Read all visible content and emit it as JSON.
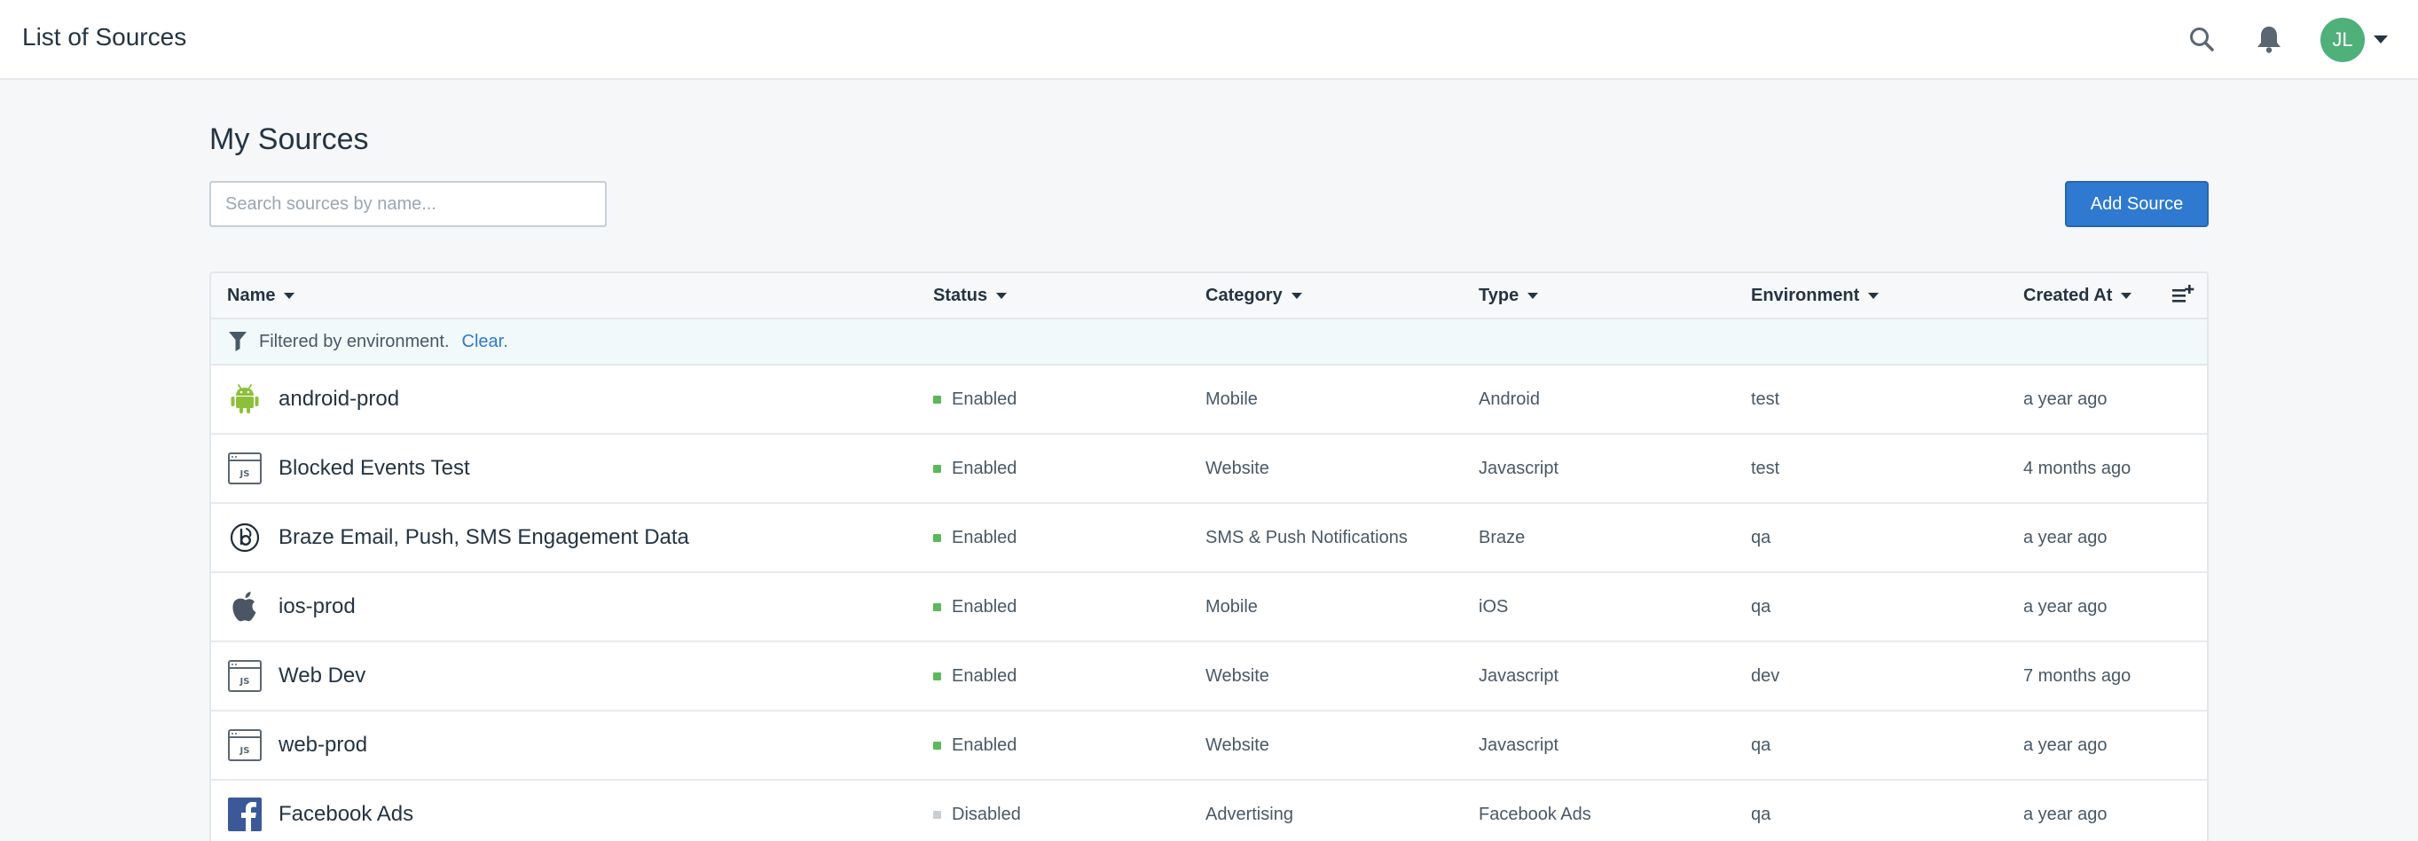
{
  "header": {
    "title": "List of Sources",
    "avatar_initials": "JL"
  },
  "page": {
    "title": "My Sources",
    "search_placeholder": "Search sources by name...",
    "add_button_label": "Add Source"
  },
  "table": {
    "columns": [
      {
        "label": "Name"
      },
      {
        "label": "Status"
      },
      {
        "label": "Category"
      },
      {
        "label": "Type"
      },
      {
        "label": "Environment"
      },
      {
        "label": "Created At"
      }
    ],
    "filter": {
      "text": "Filtered by environment.",
      "clear_label": "Clear."
    },
    "rows": [
      {
        "name": "android-prod",
        "icon": "android-icon",
        "status": "Enabled",
        "category": "Mobile",
        "type": "Android",
        "environment": "test",
        "created_at": "a year ago"
      },
      {
        "name": "Blocked Events Test",
        "icon": "javascript-icon",
        "status": "Enabled",
        "category": "Website",
        "type": "Javascript",
        "environment": "test",
        "created_at": "4 months ago"
      },
      {
        "name": "Braze Email, Push, SMS Engagement Data",
        "icon": "braze-icon",
        "status": "Enabled",
        "category": "SMS & Push Notifications",
        "type": "Braze",
        "environment": "qa",
        "created_at": "a year ago"
      },
      {
        "name": "ios-prod",
        "icon": "apple-icon",
        "status": "Enabled",
        "category": "Mobile",
        "type": "iOS",
        "environment": "qa",
        "created_at": "a year ago"
      },
      {
        "name": "Web Dev",
        "icon": "javascript-icon",
        "status": "Enabled",
        "category": "Website",
        "type": "Javascript",
        "environment": "dev",
        "created_at": "7 months ago"
      },
      {
        "name": "web-prod",
        "icon": "javascript-icon",
        "status": "Enabled",
        "category": "Website",
        "type": "Javascript",
        "environment": "qa",
        "created_at": "a year ago"
      },
      {
        "name": "Facebook Ads",
        "icon": "facebook-icon",
        "status": "Disabled",
        "category": "Advertising",
        "type": "Facebook Ads",
        "environment": "qa",
        "created_at": "a year ago"
      }
    ]
  },
  "colors": {
    "accent": "#2f7ad0",
    "enabled": "#5cb85c",
    "disabled": "#c9ced4",
    "avatar": "#4fb07a"
  }
}
